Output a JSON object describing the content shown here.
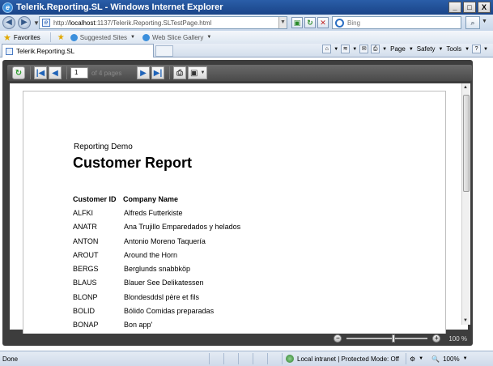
{
  "window": {
    "title": "Telerik.Reporting.SL - Windows Internet Explorer",
    "buttons": {
      "minimize": "_",
      "maximize": "□",
      "close": "X"
    }
  },
  "address": {
    "prefix": "http://",
    "host": "localhost",
    "path": ":1137/Telerik.Reporting.SLTestPage.html"
  },
  "search": {
    "placeholder": "Bing"
  },
  "favorites": {
    "label": "Favorites",
    "items": [
      "Suggested Sites",
      "Web Slice Gallery"
    ]
  },
  "tab": {
    "label": "Telerik.Reporting.SL"
  },
  "commandbar": {
    "page": "Page",
    "safety": "Safety",
    "tools": "Tools"
  },
  "viewer": {
    "page_number": "1",
    "page_of": "of 4 pages",
    "zoom": "100 %"
  },
  "report": {
    "subtitle": "Reporting Demo",
    "title": "Customer Report",
    "columns": {
      "id": "Customer ID",
      "name": "Company Name"
    },
    "rows": [
      {
        "id": "ALFKI",
        "name": "Alfreds Futterkiste"
      },
      {
        "id": "ANATR",
        "name": "Ana Trujillo Emparedados y helados"
      },
      {
        "id": "ANTON",
        "name": "Antonio Moreno Taquería"
      },
      {
        "id": "AROUT",
        "name": "Around the Horn"
      },
      {
        "id": "BERGS",
        "name": "Berglunds snabbköp"
      },
      {
        "id": "BLAUS",
        "name": "Blauer See Delikatessen"
      },
      {
        "id": "BLONP",
        "name": "Blondesddsl père et fils"
      },
      {
        "id": "BOLID",
        "name": "Bólido Comidas preparadas"
      },
      {
        "id": "BONAP",
        "name": "Bon app'"
      }
    ]
  },
  "statusbar": {
    "status": "Done",
    "zone": "Local intranet | Protected Mode: Off",
    "zoom": "100%"
  }
}
